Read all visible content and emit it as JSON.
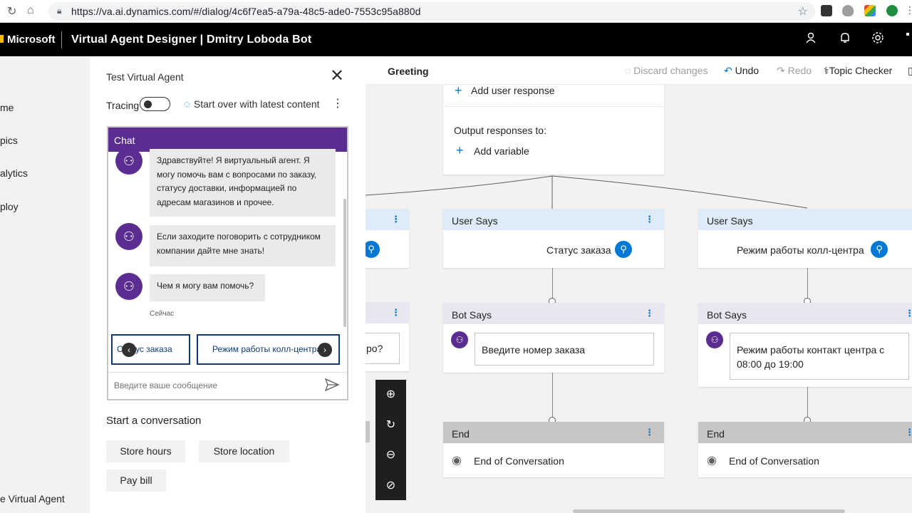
{
  "browser": {
    "url": "https://va.ai.dynamics.com/#/dialog/4c6f7ea5-a79a-48c5-ade0-7553c95a880d"
  },
  "header": {
    "brand": "Microsoft",
    "title": "Virtual Agent Designer | Dmitry Loboda Bot"
  },
  "left_nav": {
    "items": [
      "me",
      "pics",
      "alytics",
      "ploy"
    ],
    "bottom": "e Virtual Agent"
  },
  "test_panel": {
    "title": "Test Virtual Agent",
    "tracing_label": "Tracing",
    "start_over": "Start over with latest content",
    "chat_header": "Chat",
    "messages": [
      "Здравствуйте! Я виртуальный агент. Я могу помочь вам с вопросами по заказу, статусу доставки, информацией по адресам магазинов и прочее.",
      "Если заходите поговорить с сотрудником компании дайте мне знать!",
      "Чем я могу вам помочь?"
    ],
    "timestamp": "Сейчас",
    "suggestions": [
      "Статус заказа",
      "Режим работы колл-центра"
    ],
    "input_placeholder": "Введите ваше сообщение",
    "start_conversation_title": "Start a conversation",
    "quick_topics": [
      "Store hours",
      "Store location",
      "Pay bill"
    ]
  },
  "canvas": {
    "topic_name": "Greeting",
    "toolbar": {
      "discard": "Discard changes",
      "undo": "Undo",
      "redo": "Redo",
      "topic_checker": "Topic Checker"
    },
    "top_card": {
      "add_user_response": "Add user response",
      "output_label": "Output responses to:",
      "add_variable": "Add variable"
    },
    "left_partial": {
      "bot_text_fragment": "ро?"
    },
    "branch_1": {
      "user_header": "User Says",
      "user_text": "Статус заказа",
      "bot_header": "Bot Says",
      "bot_text": "Введите номер заказа",
      "end_header": "End",
      "end_text": "End of Conversation"
    },
    "branch_2": {
      "user_header": "User Says",
      "user_text": "Режим работы колл-центра",
      "bot_header": "Bot Says",
      "bot_text": "Режим работы контакт центра с 08:00 до 19:00",
      "end_header": "End",
      "end_text": "End of Conversation"
    }
  },
  "colors": {
    "accent": "#0078d4",
    "bot_purple": "#5c2d91",
    "header_bg": "#000000"
  }
}
